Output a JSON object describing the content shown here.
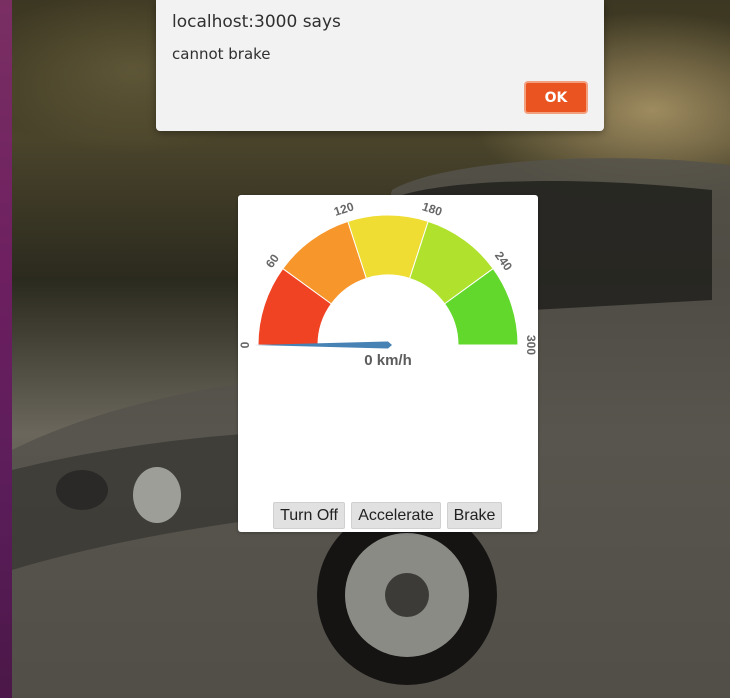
{
  "dialog": {
    "title": "localhost:3000 says",
    "message": "cannot brake",
    "ok_label": "OK",
    "accent_color": "#e95420"
  },
  "gauge": {
    "min": 0,
    "max": 300,
    "current_speed": 0,
    "speed_text": "0 km/h",
    "tick_labels": [
      "0",
      "60",
      "120",
      "180",
      "240",
      "300"
    ],
    "segment_colors": [
      "#f04323",
      "#f7962a",
      "#efdd33",
      "#b0e22d",
      "#62d82c"
    ],
    "needle_color": "#4682b4"
  },
  "controls": {
    "turn_off_label": "Turn Off",
    "accelerate_label": "Accelerate",
    "brake_label": "Brake"
  },
  "desktop": {
    "accent_color": "#6d1f60"
  }
}
